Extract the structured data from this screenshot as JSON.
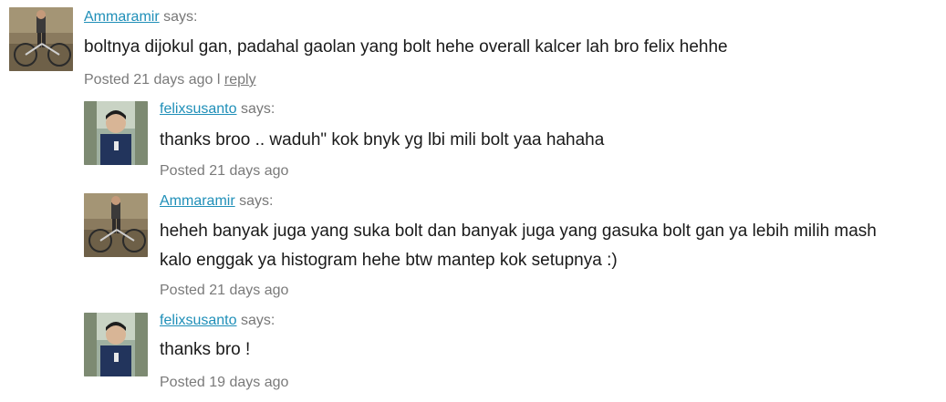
{
  "comments": [
    {
      "author": "Ammaramir",
      "says": "says:",
      "text_lines": [
        "boltnya dijokul gan, padahal gaolan yang bolt hehe overall kalcer lah bro felix hehhe"
      ],
      "posted": "Posted 21 days ago",
      "separator": "l",
      "reply": "reply",
      "avatar": "bicycle-photo"
    },
    {
      "author": "felixsusanto",
      "says": "says:",
      "text_lines": [
        "thanks broo .. waduh\" kok bnyk yg lbi mili bolt yaa hahaha"
      ],
      "posted": "Posted 21 days ago",
      "avatar": "portrait-photo"
    },
    {
      "author": "Ammaramir",
      "says": "says:",
      "text_lines": [
        "heheh banyak juga yang suka bolt dan banyak juga yang gasuka bolt gan ya lebih milih mash",
        "kalo enggak ya histogram hehe btw mantep kok setupnya :)"
      ],
      "posted": "Posted 21 days ago",
      "avatar": "bicycle-photo"
    },
    {
      "author": "felixsusanto",
      "says": "says:",
      "text_lines": [
        "thanks bro !"
      ],
      "posted": "Posted 19 days ago",
      "avatar": "portrait-photo"
    }
  ],
  "colors": {
    "link": "#1f8fb8",
    "meta": "#777777",
    "text": "#1a1a1a"
  }
}
